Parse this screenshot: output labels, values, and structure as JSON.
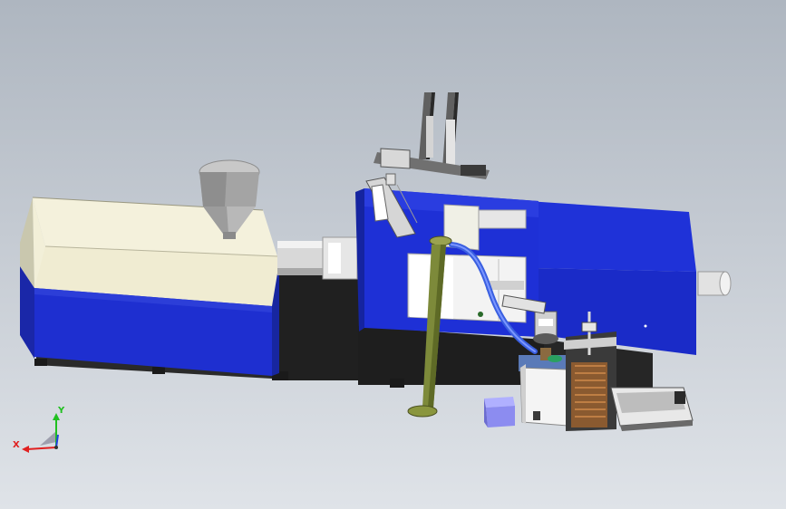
{
  "viewport": {
    "background_top": "#aeb6c0",
    "background_bottom": "#dfe3e8"
  },
  "model": {
    "parts": [
      "injection-unit",
      "hopper",
      "clamping-unit",
      "tie-bars",
      "gantry-robot",
      "support-column",
      "conveyor-hose",
      "auxiliary-cabinet",
      "part-rack",
      "end-fixture",
      "collection-bin"
    ],
    "colors": {
      "machine_blue": "#1e2fd0",
      "panel_cream": "#f4f1dc",
      "steel_grey": "#b5b5b5",
      "column_olive": "#7d8a3a",
      "hose_blue": "#3a5fe0",
      "rack_brown": "#8a5a30",
      "bin_lavender": "#8c8cf0",
      "shadow": "#262626"
    }
  },
  "triad": {
    "x_label": "X",
    "y_label": "Y",
    "x_color": "#e02020",
    "y_color": "#20c020",
    "z_color": "#2040e0",
    "icon": "coordinate-triad-icon"
  }
}
